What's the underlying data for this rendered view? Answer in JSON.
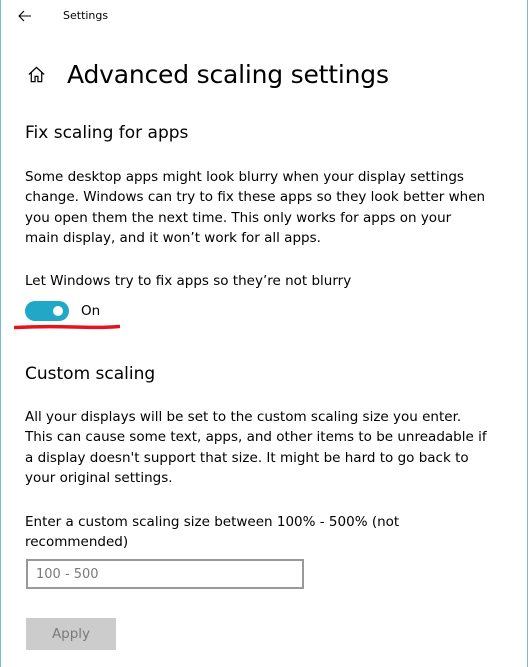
{
  "window": {
    "app_title": "Settings"
  },
  "header": {
    "title": "Advanced scaling settings"
  },
  "fix_scaling": {
    "title": "Fix scaling for apps",
    "description": "Some desktop apps might look blurry when your display settings change. Windows can try to fix these apps so they look better when you open them the next time. This only works for apps on your main display, and it won’t work for all apps.",
    "toggle_label": "Let Windows try to fix apps so they’re not blurry",
    "toggle_state": "On",
    "toggle_on": true
  },
  "custom_scaling": {
    "title": "Custom scaling",
    "description": "All your displays will be set to the custom scaling size you enter. This can cause some text, apps, and other items to be unreadable if a display doesn't support that size. It might be hard to go back to your original settings.",
    "input_label": "Enter a custom scaling size between 100% - 500% (not recommended)",
    "input_value": "",
    "input_placeholder": "100 - 500",
    "apply_label": "Apply"
  },
  "icons": {
    "back": "back-arrow-icon",
    "home": "home-icon"
  },
  "colors": {
    "toggle_on": "#21a8c6",
    "annotation": "#e8121b",
    "button_disabled_bg": "#cccccc",
    "button_disabled_text": "#7a7a7a",
    "window_border": "#7fb6e0"
  }
}
